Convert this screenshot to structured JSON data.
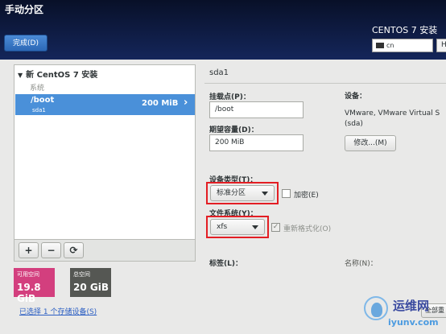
{
  "header": {
    "title": "手动分区",
    "done_label": "完成(D)",
    "product": "CENTOS 7 安装",
    "keyboard_layout": "cn",
    "help_label": "H"
  },
  "partition_tree": {
    "root_label": "新 CentOS 7 安装",
    "group_label": "系统",
    "selected": {
      "mount_point": "/boot",
      "device": "sda1",
      "size": "200 MiB"
    }
  },
  "toolbar": {
    "add": "+",
    "remove": "−",
    "refresh": "⟳"
  },
  "space": {
    "available_label": "可用空间",
    "available_value": "19.8 GiB",
    "total_label": "总空间",
    "total_value": "20 GiB"
  },
  "storage_link": "已选择 1 个存储设备(S)",
  "details": {
    "title": "sda1",
    "mount_point_label": "挂载点(P)：",
    "mount_point_value": "/boot",
    "capacity_label": "期望容量(D)：",
    "capacity_value": "200 MiB",
    "device_label": "设备：",
    "device_desc_line1": "VMware, VMware Virtual S",
    "device_desc_line2": "(sda)",
    "modify_label": "修改...(M)",
    "device_type_label": "设备类型(T)：",
    "device_type_value": "标准分区",
    "encrypt_label": "加密(E)",
    "filesystem_label": "文件系统(Y)：",
    "filesystem_value": "xfs",
    "reformat_label": "重新格式化(O)",
    "tag_label": "标签(L)：",
    "name_label": "名称(N)：",
    "reset_label": "全部重"
  },
  "watermark": {
    "name": "运维网",
    "url": "iyunv.com"
  },
  "colors": {
    "selection": "#4a90d9",
    "available": "#d33f7e",
    "total": "#555753",
    "highlight": "#e31e24"
  }
}
